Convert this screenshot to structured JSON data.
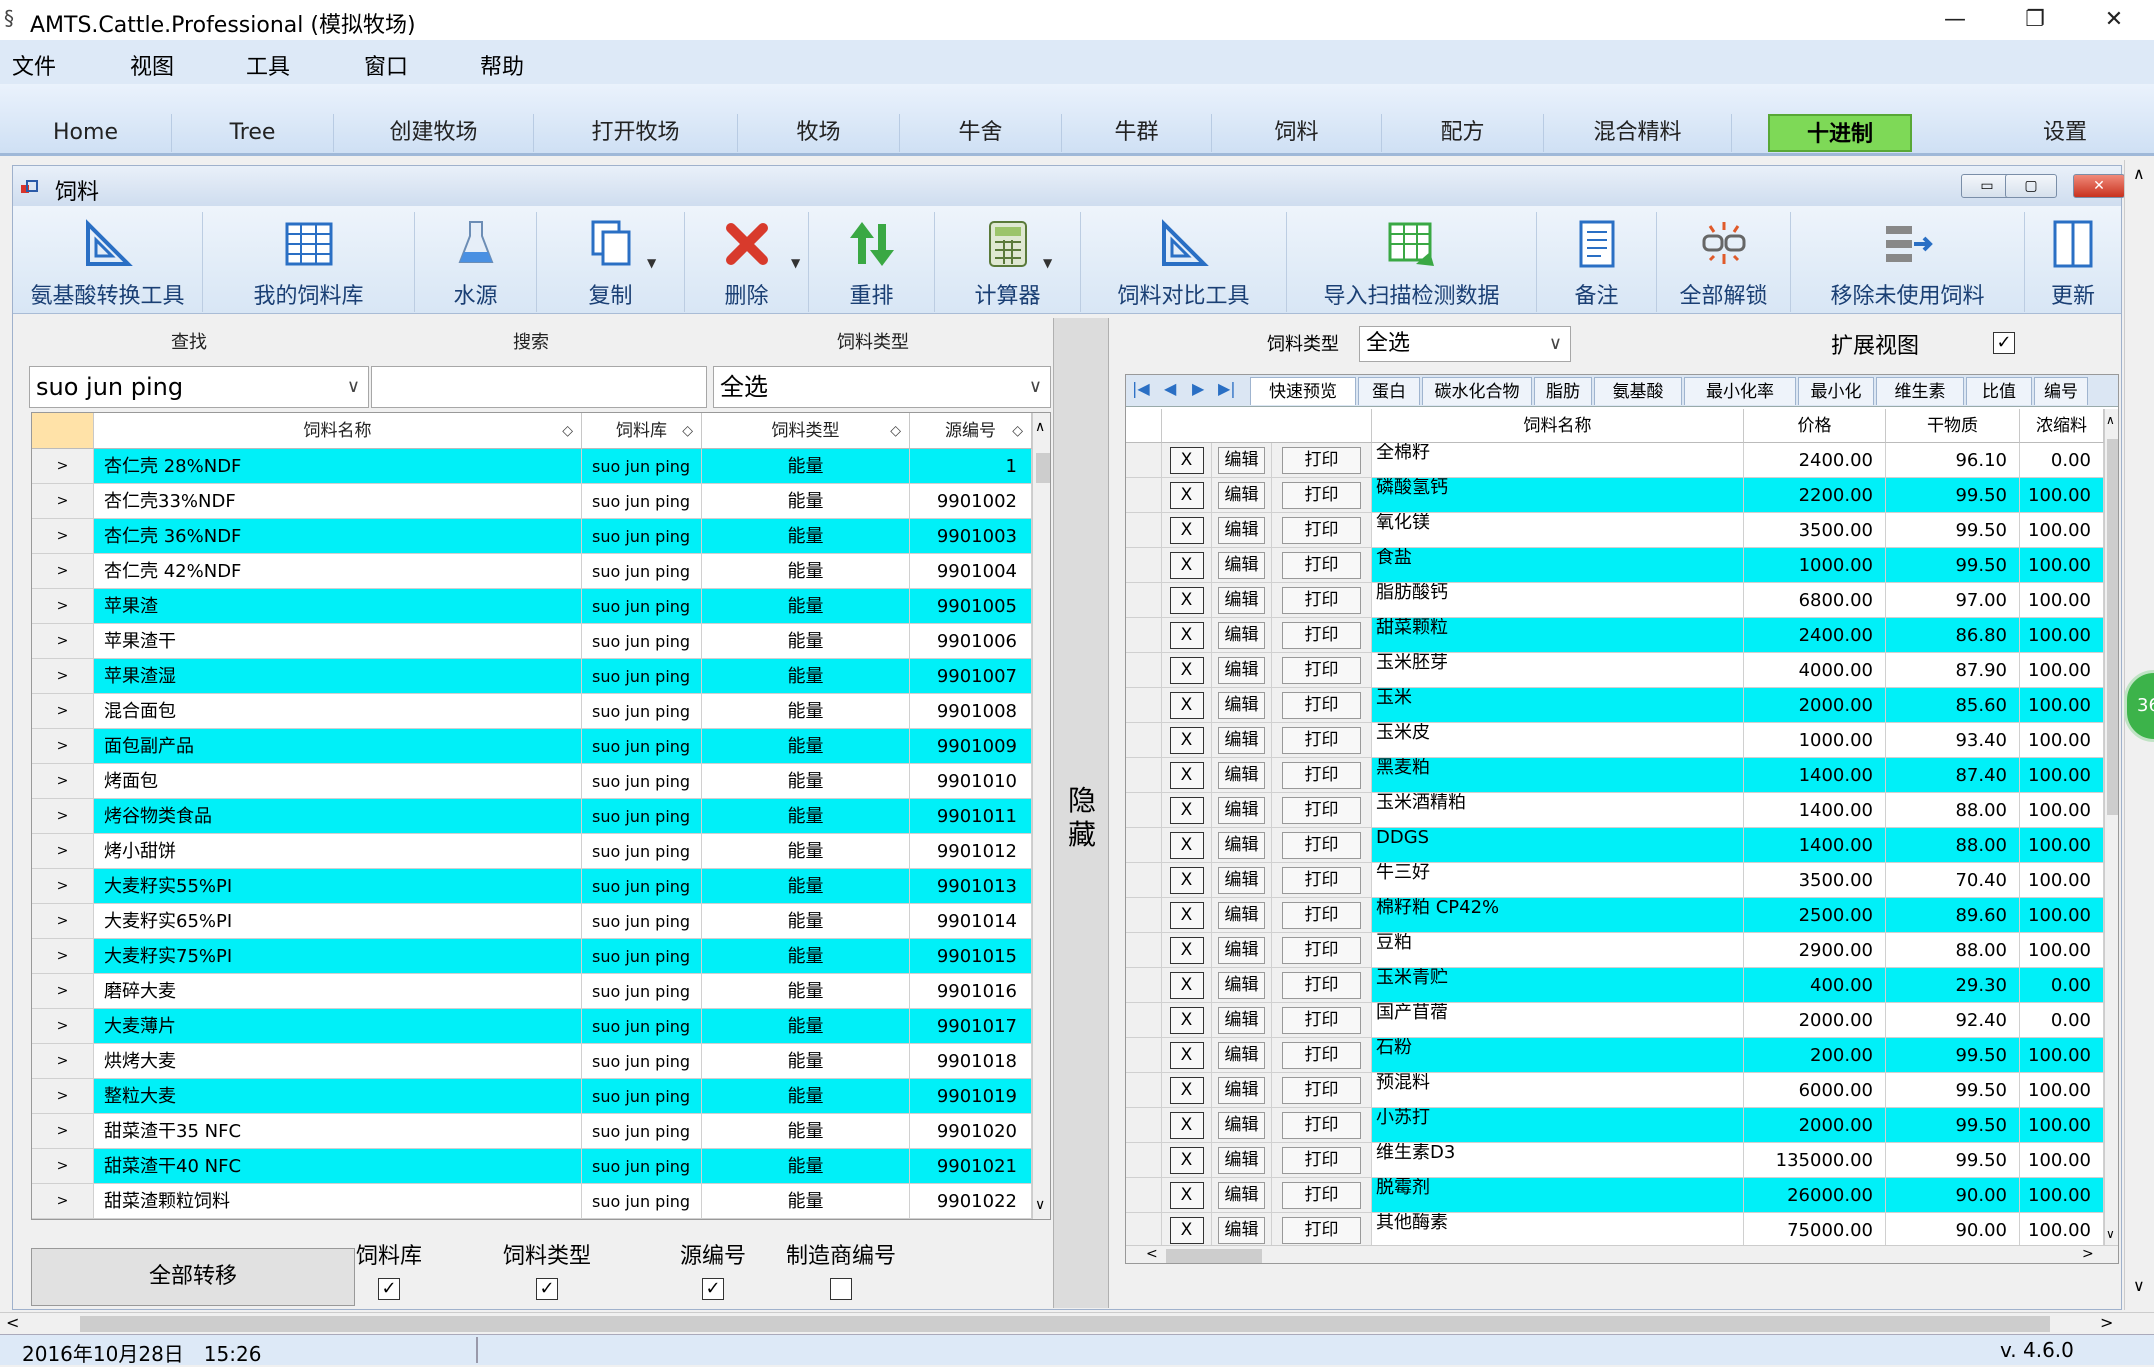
{
  "app_title": "AMTS.Cattle.Professional (模拟牧场)",
  "window_controls": {
    "minimize": "—",
    "restore": "❐",
    "close": "✕"
  },
  "menu": [
    "文件",
    "视图",
    "工具",
    "窗口",
    "帮助"
  ],
  "nav_tabs": [
    "Home",
    "Tree",
    "创建牧场",
    "打开牧场",
    "牧场",
    "牛舍",
    "牛群",
    "饲料",
    "配方",
    "混合精料",
    "十进制",
    "设置"
  ],
  "child_window": {
    "title": "饲料",
    "buttons": [
      "▭",
      "▢",
      "✕"
    ]
  },
  "toolbar": [
    "氨基酸转换工具",
    "我的饲料库",
    "水源",
    "复制",
    "删除",
    "重排",
    "计算器",
    "饲料对比工具",
    "导入扫描检测数据",
    "备注",
    "全部解锁",
    "移除未使用饲料",
    "更新"
  ],
  "left": {
    "labels": {
      "find": "查找",
      "search": "搜索",
      "feed_type": "饲料类型"
    },
    "find_value": "suo jun ping",
    "search_value": "",
    "type_value": "全选",
    "columns": [
      "饲料名称",
      "饲料库",
      "饲料类型",
      "源编号"
    ],
    "row_btn": ">",
    "rows": [
      [
        "杏仁壳 28%NDF",
        "suo jun ping",
        "能量",
        "1"
      ],
      [
        "杏仁壳33%NDF",
        "suo jun ping",
        "能量",
        "9901002"
      ],
      [
        "杏仁壳 36%NDF",
        "suo jun ping",
        "能量",
        "9901003"
      ],
      [
        "杏仁壳 42%NDF",
        "suo jun ping",
        "能量",
        "9901004"
      ],
      [
        "苹果渣",
        "suo jun ping",
        "能量",
        "9901005"
      ],
      [
        "苹果渣干",
        "suo jun ping",
        "能量",
        "9901006"
      ],
      [
        "苹果渣湿",
        "suo jun ping",
        "能量",
        "9901007"
      ],
      [
        "混合面包",
        "suo jun ping",
        "能量",
        "9901008"
      ],
      [
        "面包副产品",
        "suo jun ping",
        "能量",
        "9901009"
      ],
      [
        "烤面包",
        "suo jun ping",
        "能量",
        "9901010"
      ],
      [
        "烤谷物类食品",
        "suo jun ping",
        "能量",
        "9901011"
      ],
      [
        "烤小甜饼",
        "suo jun ping",
        "能量",
        "9901012"
      ],
      [
        "大麦籽实55%PI",
        "suo jun ping",
        "能量",
        "9901013"
      ],
      [
        "大麦籽实65%PI",
        "suo jun ping",
        "能量",
        "9901014"
      ],
      [
        "大麦籽实75%PI",
        "suo jun ping",
        "能量",
        "9901015"
      ],
      [
        "磨碎大麦",
        "suo jun ping",
        "能量",
        "9901016"
      ],
      [
        "大麦薄片",
        "suo jun ping",
        "能量",
        "9901017"
      ],
      [
        "烘烤大麦",
        "suo jun ping",
        "能量",
        "9901018"
      ],
      [
        "整粒大麦",
        "suo jun ping",
        "能量",
        "9901019"
      ],
      [
        "甜菜渣干35 NFC",
        "suo jun ping",
        "能量",
        "9901020"
      ],
      [
        "甜菜渣干40 NFC",
        "suo jun ping",
        "能量",
        "9901021"
      ],
      [
        "甜菜渣颗粒饲料",
        "suo jun ping",
        "能量",
        "9901022"
      ]
    ],
    "transfer_all": "全部转移",
    "bottom_checks": [
      {
        "label": "饲料库",
        "checked": true
      },
      {
        "label": "饲料类型",
        "checked": true
      },
      {
        "label": "源编号",
        "checked": true
      },
      {
        "label": "制造商编号",
        "checked": false
      }
    ]
  },
  "splitter_label": "隐藏",
  "right": {
    "type_label": "饲料类型",
    "type_value": "全选",
    "extended_view_label": "扩展视图",
    "extended_view_checked": true,
    "nav_arrows": [
      "|◀",
      "◀",
      "▶",
      "▶|"
    ],
    "tabs": [
      "快速预览",
      "蛋白",
      "碳水化合物",
      "脂肪",
      "氨基酸",
      "最小化率",
      "最小化",
      "维生素",
      "比值",
      "编号"
    ],
    "columns": [
      "饲料名称",
      "价格",
      "干物质",
      "浓缩料"
    ],
    "btn_x": "X",
    "btn_edit": "编辑",
    "btn_print": "打印",
    "rows": [
      [
        "全棉籽",
        "2400.00",
        "96.10",
        "0.00"
      ],
      [
        "磷酸氢钙",
        "2200.00",
        "99.50",
        "100.00"
      ],
      [
        "氧化镁",
        "3500.00",
        "99.50",
        "100.00"
      ],
      [
        "食盐",
        "1000.00",
        "99.50",
        "100.00"
      ],
      [
        "脂肪酸钙",
        "6800.00",
        "97.00",
        "100.00"
      ],
      [
        "甜菜颗粒",
        "2400.00",
        "86.80",
        "100.00"
      ],
      [
        "玉米胚芽",
        "4000.00",
        "87.90",
        "100.00"
      ],
      [
        "玉米",
        "2000.00",
        "85.60",
        "100.00"
      ],
      [
        "玉米皮",
        "1000.00",
        "93.40",
        "100.00"
      ],
      [
        "黑麦粕",
        "1400.00",
        "87.40",
        "100.00"
      ],
      [
        "玉米酒精粕",
        "1400.00",
        "88.00",
        "100.00"
      ],
      [
        "DDGS",
        "1400.00",
        "88.00",
        "100.00"
      ],
      [
        "牛三好",
        "3500.00",
        "70.40",
        "100.00"
      ],
      [
        "棉籽粕 CP42%",
        "2500.00",
        "89.60",
        "100.00"
      ],
      [
        "豆粕",
        "2900.00",
        "88.00",
        "100.00"
      ],
      [
        "玉米青贮",
        "400.00",
        "29.30",
        "0.00"
      ],
      [
        "国产苜蓿",
        "2000.00",
        "92.40",
        "0.00"
      ],
      [
        "石粉",
        "200.00",
        "99.50",
        "100.00"
      ],
      [
        "预混料",
        "6000.00",
        "99.50",
        "100.00"
      ],
      [
        "小苏打",
        "2000.00",
        "99.50",
        "100.00"
      ],
      [
        "维生素D3",
        "135000.00",
        "99.50",
        "100.00"
      ],
      [
        "脱霉剂",
        "26000.00",
        "90.00",
        "100.00"
      ],
      [
        "其他酶素",
        "75000.00",
        "90.00",
        "100.00"
      ]
    ]
  },
  "status": {
    "datetime": "2016年10月28日　15:26",
    "version": "v. 4.6.0"
  },
  "side_badge": "36",
  "colors": {
    "highlight_row": "#00f0f8",
    "active_tab": "#7ed957",
    "menu_bg": "#dde9f7"
  }
}
